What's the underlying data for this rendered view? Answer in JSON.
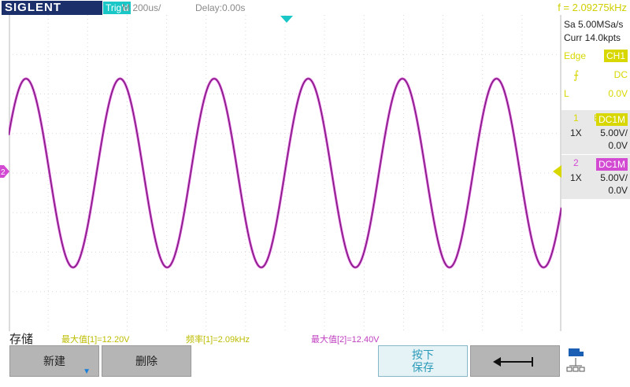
{
  "header": {
    "brand": "SIGLENT",
    "trigger_status": "Trig'd",
    "timebase": "M 200us/",
    "delay": "Delay:0.00s",
    "frequency": "f = 2.09275kHz"
  },
  "acquisition": {
    "sample_rate": "Sa 5.00MSa/s",
    "memory": "Curr 14.0kpts"
  },
  "trigger": {
    "mode_label": "Edge",
    "source": "CH1",
    "slope_symbol": "⨍",
    "coupling": "DC",
    "level_label": "L",
    "level": "0.0V"
  },
  "channels": [
    {
      "number": "1",
      "bandwidth": "B",
      "coupling": "DC1M",
      "probe": "1X",
      "scale": "5.00V/",
      "offset": "0.0V"
    },
    {
      "number": "2",
      "bandwidth": "",
      "coupling": "DC1M",
      "probe": "1X",
      "scale": "5.00V/",
      "offset": "0.0V"
    }
  ],
  "colors": {
    "ch1": "#d8d800",
    "ch2": "#d24bd2",
    "trigger_marker": "#19c7c7"
  },
  "markers": {
    "ch2_left": "2"
  },
  "measurements": {
    "menu_title": "存储",
    "max1": "最大值[1]=12.20V",
    "freq1": "频率[1]=2.09kHz",
    "max2": "最大值[2]=12.40V"
  },
  "softkeys": {
    "new": "新建",
    "delete": "删除",
    "press_line1": "按下",
    "press_line2": "保存",
    "back_icon": "return-arrow-icon",
    "network_icon": "network-icon"
  }
}
